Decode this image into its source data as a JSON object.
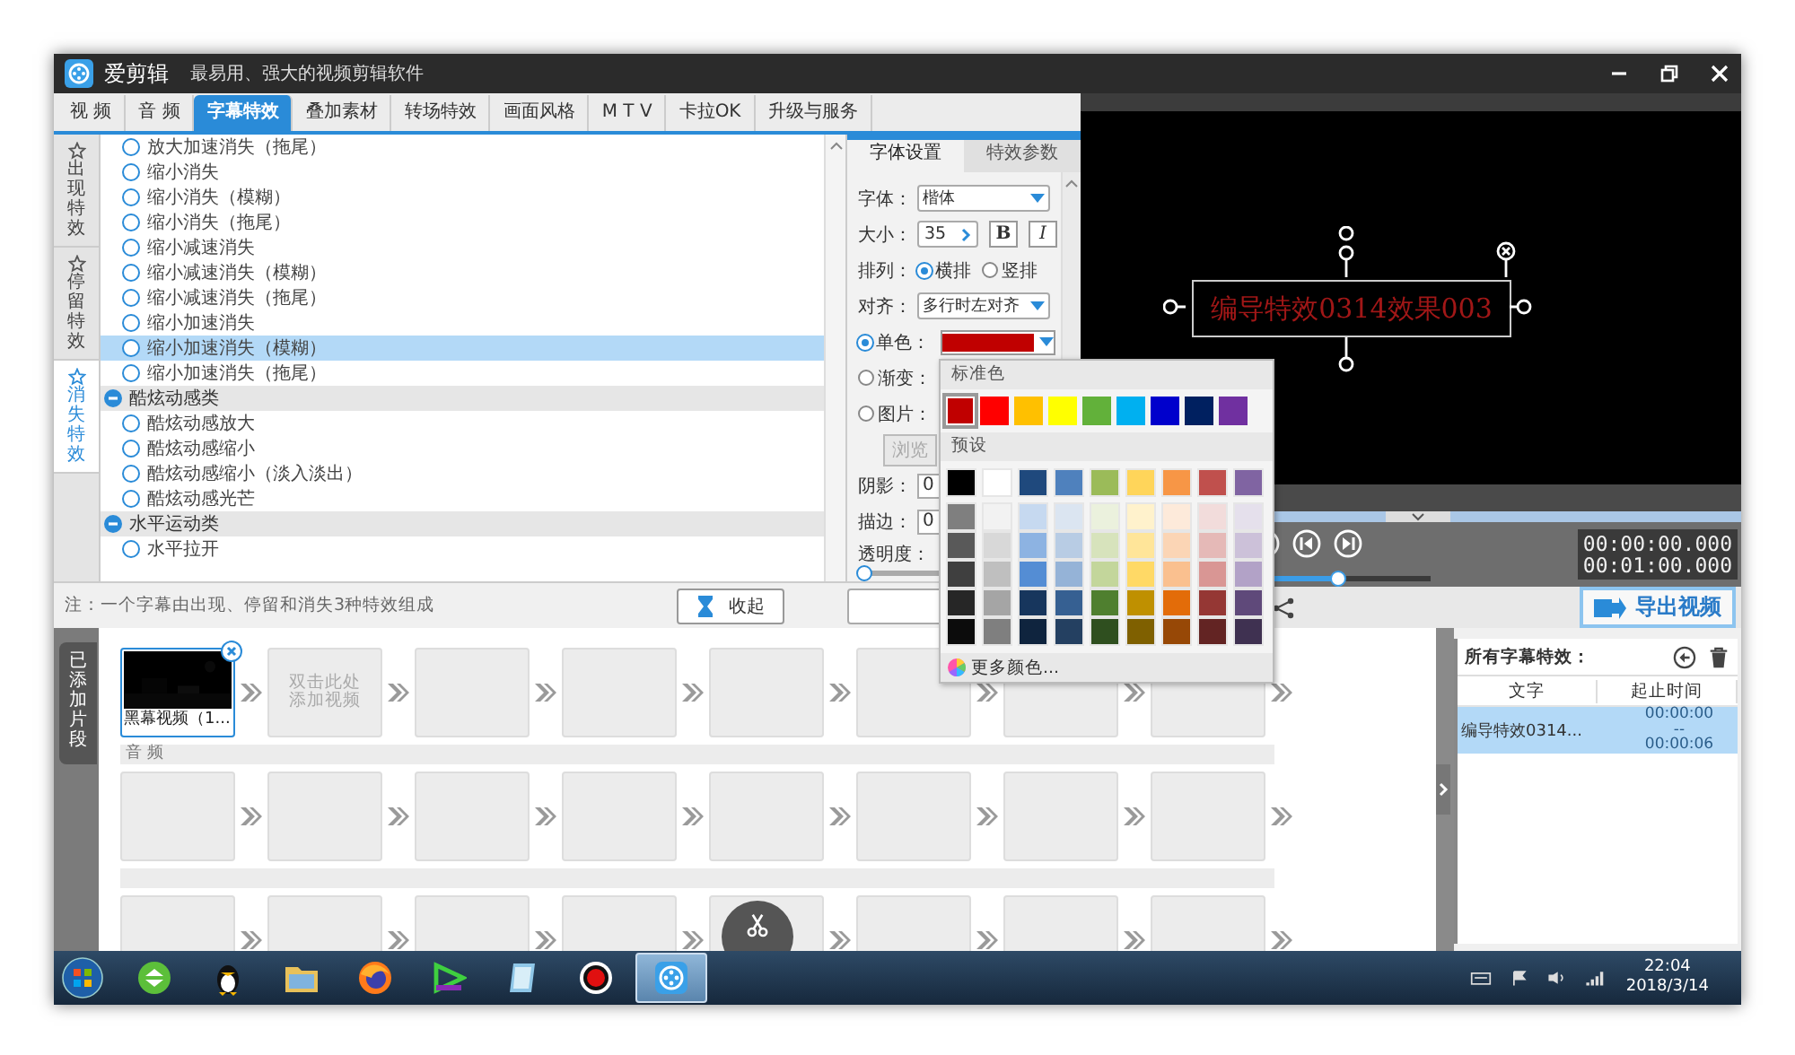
{
  "app": {
    "name": "爱剪辑",
    "slogan": "最易用、强大的视频剪辑软件"
  },
  "tabs": [
    {
      "label": "视 频",
      "selected": false
    },
    {
      "label": "音 频",
      "selected": false
    },
    {
      "label": "字幕特效",
      "selected": true
    },
    {
      "label": "叠加素材",
      "selected": false
    },
    {
      "label": "转场特效",
      "selected": false
    },
    {
      "label": "画面风格",
      "selected": false
    },
    {
      "label": "M T V",
      "selected": false
    },
    {
      "label": "卡拉OK",
      "selected": false
    },
    {
      "label": "升级与服务",
      "selected": false
    }
  ],
  "effect_categories": [
    {
      "label": "出现特效",
      "selected": false
    },
    {
      "label": "停留特效",
      "selected": false
    },
    {
      "label": "消失特效",
      "selected": true
    }
  ],
  "effect_list": [
    {
      "kind": "item",
      "label": "放大加速消失（拖尾）",
      "selected": false
    },
    {
      "kind": "item",
      "label": "缩小消失",
      "selected": false
    },
    {
      "kind": "item",
      "label": "缩小消失（模糊）",
      "selected": false
    },
    {
      "kind": "item",
      "label": "缩小消失（拖尾）",
      "selected": false
    },
    {
      "kind": "item",
      "label": "缩小减速消失",
      "selected": false
    },
    {
      "kind": "item",
      "label": "缩小减速消失（模糊）",
      "selected": false
    },
    {
      "kind": "item",
      "label": "缩小减速消失（拖尾）",
      "selected": false
    },
    {
      "kind": "item",
      "label": "缩小加速消失",
      "selected": false
    },
    {
      "kind": "item",
      "label": "缩小加速消失（模糊）",
      "selected": true
    },
    {
      "kind": "item",
      "label": "缩小加速消失（拖尾）",
      "selected": false
    },
    {
      "kind": "group",
      "label": "酷炫动感类",
      "expanded": true,
      "children": [
        {
          "kind": "item",
          "label": "酷炫动感放大",
          "selected": false
        },
        {
          "kind": "item",
          "label": "酷炫动感缩小",
          "selected": false
        },
        {
          "kind": "item",
          "label": "酷炫动感缩小（淡入淡出）",
          "selected": false
        },
        {
          "kind": "item",
          "label": "酷炫动感光芒",
          "selected": false
        }
      ]
    },
    {
      "kind": "group",
      "label": "水平运动类",
      "expanded": true,
      "children": [
        {
          "kind": "item",
          "label": "水平拉开",
          "selected": false
        }
      ]
    }
  ],
  "note": "注：一个字幕由出现、停留和消失3种特效组成",
  "collapse_button": "收起",
  "settings": {
    "tabs": [
      {
        "label": "字体设置",
        "selected": true
      },
      {
        "label": "特效参数",
        "selected": false
      }
    ],
    "font_label": "字体：",
    "font": "楷体",
    "size_label": "大小：",
    "size": "35",
    "bold": {
      "label": "B",
      "on": false
    },
    "italic": {
      "label": "I",
      "on": false
    },
    "layout_label": "排列：",
    "layouts": [
      {
        "label": "横排",
        "selected": true
      },
      {
        "label": "竖排",
        "selected": false
      }
    ],
    "align_label": "对齐：",
    "align": "多行时左对齐",
    "fills": [
      {
        "kind": "solid",
        "label": "单色：",
        "selected": true,
        "color": "#c00000"
      },
      {
        "kind": "gradient",
        "label": "渐变：",
        "selected": false
      },
      {
        "label": "图片：",
        "selected": false
      }
    ],
    "browse_button": {
      "label": "浏览",
      "disabled": true
    },
    "shadow_label": "阴影：",
    "shadow": "0",
    "stroke_label": "描边：",
    "stroke": "0",
    "opacity_label": "透明度：",
    "opacity": {
      "level": 0
    }
  },
  "color_popup": {
    "standard_label": "标准色",
    "standard": [
      {
        "color": "#c00000",
        "selected": true
      },
      {
        "color": "#ff0000",
        "selected": false
      },
      {
        "color": "#ffc000",
        "selected": false
      },
      {
        "color": "#ffff00",
        "selected": false
      },
      {
        "color": "#62b13a",
        "selected": false
      },
      {
        "color": "#00b0f0",
        "selected": false
      },
      {
        "color": "#0000cc",
        "selected": false
      },
      {
        "color": "#002060",
        "selected": false
      },
      {
        "color": "#7030a0",
        "selected": false
      }
    ],
    "preset_label": "预设",
    "preset_rows": [
      [
        {
          "color": "#000000"
        },
        {
          "color": "#ffffff"
        },
        {
          "color": "#1f497d"
        },
        {
          "color": "#4f81bd"
        },
        {
          "color": "#9bbb59"
        },
        {
          "color": "#ffd55a"
        },
        {
          "color": "#f79646"
        },
        {
          "color": "#c0504d"
        },
        {
          "color": "#8064a2"
        }
      ],
      [
        {
          "color": "#7f7f7f"
        },
        {
          "color": "#f2f2f2"
        },
        {
          "color": "#c6d9f0"
        },
        {
          "color": "#dbe5f1"
        },
        {
          "color": "#ebf1dd"
        },
        {
          "color": "#fff2cc"
        },
        {
          "color": "#fdeada"
        },
        {
          "color": "#f2dcdb"
        },
        {
          "color": "#e5e0ec"
        }
      ],
      [
        {
          "color": "#595959"
        },
        {
          "color": "#d8d8d8"
        },
        {
          "color": "#8db3e2"
        },
        {
          "color": "#b8cce4"
        },
        {
          "color": "#d7e3bc"
        },
        {
          "color": "#ffe599"
        },
        {
          "color": "#fbd5b5"
        },
        {
          "color": "#e5b9b7"
        },
        {
          "color": "#ccc1d9"
        }
      ],
      [
        {
          "color": "#3f3f3f"
        },
        {
          "color": "#bfbfbf"
        },
        {
          "color": "#548dd4"
        },
        {
          "color": "#95b3d7"
        },
        {
          "color": "#c3d69b"
        },
        {
          "color": "#ffd966"
        },
        {
          "color": "#fac08f"
        },
        {
          "color": "#d99694"
        },
        {
          "color": "#b2a2c7"
        }
      ],
      [
        {
          "color": "#262626"
        },
        {
          "color": "#a5a5a5"
        },
        {
          "color": "#17365d"
        },
        {
          "color": "#366092"
        },
        {
          "color": "#4f7f2f"
        },
        {
          "color": "#bf9000"
        },
        {
          "color": "#e36c09"
        },
        {
          "color": "#953734"
        },
        {
          "color": "#5f497a"
        }
      ],
      [
        {
          "color": "#0c0c0c"
        },
        {
          "color": "#7f7f7f"
        },
        {
          "color": "#0f243e"
        },
        {
          "color": "#244061"
        },
        {
          "color": "#2f4f1f"
        },
        {
          "color": "#7f6000"
        },
        {
          "color": "#974806"
        },
        {
          "color": "#632423"
        },
        {
          "color": "#3f3151"
        }
      ]
    ],
    "more_colors": "更多颜色..."
  },
  "preview": {
    "subtitle": "编导特效0314效果003"
  },
  "player": {
    "current_time": "00:00:00.000",
    "total_time": "00:01:00.000",
    "volume": {
      "level": 0.63
    }
  },
  "export_button": "导出视频",
  "clips_tab": "已添加片段",
  "video_track": [
    {
      "kind": "clip",
      "label": "黑幕视频（1...",
      "selected": true
    },
    {
      "kind": "add",
      "label": "双击此处添加视频"
    },
    {
      "kind": "empty"
    },
    {
      "kind": "empty"
    },
    {
      "kind": "empty"
    },
    {
      "kind": "empty"
    },
    {
      "kind": "empty"
    },
    {
      "kind": "empty"
    }
  ],
  "audio_label": "音 频",
  "audio_track": [
    {
      "kind": "empty"
    },
    {
      "kind": "empty"
    },
    {
      "kind": "empty"
    },
    {
      "kind": "empty"
    },
    {
      "kind": "empty"
    },
    {
      "kind": "empty"
    },
    {
      "kind": "empty"
    },
    {
      "kind": "empty"
    }
  ],
  "track_3": [
    {
      "kind": "empty"
    },
    {
      "kind": "empty"
    },
    {
      "kind": "empty"
    },
    {
      "kind": "empty"
    },
    {
      "kind": "empty"
    },
    {
      "kind": "empty"
    },
    {
      "kind": "empty"
    },
    {
      "kind": "empty"
    }
  ],
  "subtitle_panel": {
    "title": "所有字幕特效：",
    "columns": [
      "文字",
      "起止时间"
    ],
    "rows": [
      {
        "text": "编导特效0314...",
        "start": "00:00:00",
        "separator": "--",
        "end": "00:00:06",
        "selected": true
      }
    ]
  },
  "taskbar": {
    "apps": [
      {
        "kind": "refresh",
        "active": false
      },
      {
        "kind": "penguin",
        "active": false
      },
      {
        "kind": "folder",
        "active": false
      },
      {
        "kind": "globe",
        "active": false
      },
      {
        "kind": "play",
        "active": false
      },
      {
        "kind": "notepad",
        "active": false
      },
      {
        "kind": "record",
        "active": false
      },
      {
        "kind": "film",
        "active": true
      }
    ],
    "clock": "22:04",
    "date": "2018/3/14"
  }
}
